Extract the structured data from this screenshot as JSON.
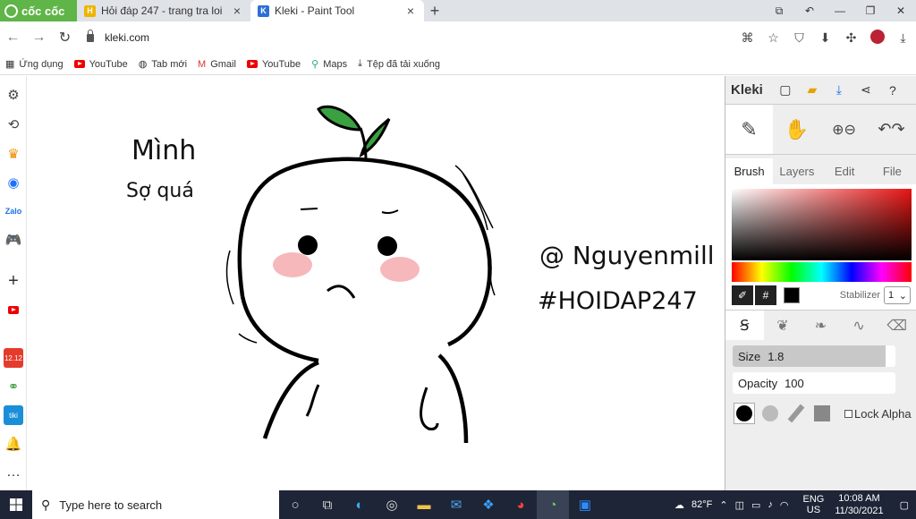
{
  "browser": {
    "logo_text": "cốc cốc",
    "tabs": [
      {
        "title": "Hỏi đáp 247 - trang tra loi",
        "fav": "H",
        "color": "#f0b400"
      },
      {
        "title": "Kleki - Paint Tool",
        "fav": "K",
        "color": "#2d6fd6"
      }
    ],
    "url": "kleki.com"
  },
  "bookmarks": [
    {
      "label": "Ứng dụng",
      "icon": "apps-grid-icon"
    },
    {
      "label": "YouTube",
      "icon": "youtube-icon"
    },
    {
      "label": "Tab mới",
      "icon": "globe-icon"
    },
    {
      "label": "Gmail",
      "icon": "gmail-icon"
    },
    {
      "label": "YouTube",
      "icon": "youtube-icon"
    },
    {
      "label": "Maps",
      "icon": "maps-icon"
    },
    {
      "label": "Tệp đã tải xuống",
      "icon": "download-icon"
    }
  ],
  "kleki": {
    "name": "Kleki",
    "tabs": [
      "Brush",
      "Layers",
      "Edit",
      "File"
    ],
    "active_tab": "Brush",
    "stabilizer_label": "Stabilizer",
    "stabilizer_value": "1",
    "size_label": "Size",
    "size_value": "1.8",
    "size_fraction": 0.94,
    "opacity_label": "Opacity",
    "opacity_value": "100",
    "opacity_fraction": 1.0,
    "lock_alpha": "Lock Alpha",
    "current_color": "#000000"
  },
  "drawing": {
    "text_left_1": "Mình",
    "text_left_2": "Sợ quá",
    "text_right_1": "@ Nguyenmill",
    "text_right_2": "#HOIDAP247"
  },
  "taskbar": {
    "search_placeholder": "Type here to search",
    "weather": "82°F",
    "lang_1": "ENG",
    "lang_2": "US",
    "time": "10:08 AM",
    "date": "11/30/2021"
  }
}
